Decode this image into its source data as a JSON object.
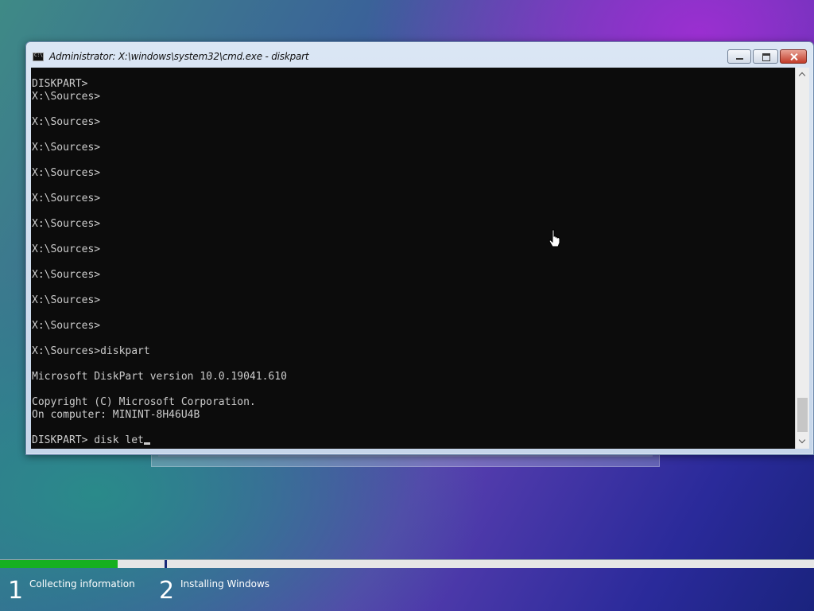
{
  "window": {
    "title": "Administrator: X:\\windows\\system32\\cmd.exe - diskpart",
    "icon": "cmd-icon"
  },
  "console": {
    "lines": [
      "DISKPART>",
      "X:\\Sources>",
      "",
      "X:\\Sources>",
      "",
      "X:\\Sources>",
      "",
      "X:\\Sources>",
      "",
      "X:\\Sources>",
      "",
      "X:\\Sources>",
      "",
      "X:\\Sources>",
      "",
      "X:\\Sources>",
      "",
      "X:\\Sources>",
      "",
      "X:\\Sources>",
      "",
      "X:\\Sources>diskpart",
      "",
      "Microsoft DiskPart version 10.0.19041.610",
      "",
      "Copyright (C) Microsoft Corporation.",
      "On computer: MININT-8H46U4B",
      ""
    ],
    "current_input": "DISKPART> disk let"
  },
  "setup_progress": {
    "fraction": 0.145,
    "steps": [
      {
        "number": "1",
        "label": "Collecting information"
      },
      {
        "number": "2",
        "label": "Installing Windows"
      }
    ]
  },
  "colors": {
    "console_bg": "#0c0c0c",
    "console_text": "#cccccc",
    "progress": "#16b020"
  }
}
